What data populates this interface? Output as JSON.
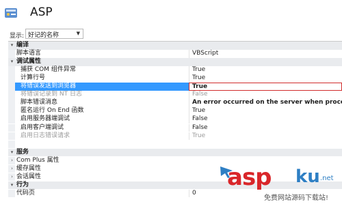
{
  "header": {
    "title": "ASP"
  },
  "toolbar": {
    "display_label": "显示:",
    "display_value": "好记的名称"
  },
  "grid": {
    "rows": [
      {
        "type": "cat",
        "label": "编译",
        "expander": "▾"
      },
      {
        "type": "item",
        "label": "脚本语言",
        "value": "VBScript"
      },
      {
        "type": "cat",
        "label": "调试属性",
        "expander": "▾"
      },
      {
        "type": "sub",
        "label": "捕获 COM 组件异常",
        "value": "True"
      },
      {
        "type": "sub",
        "label": "计算行号",
        "value": "True"
      },
      {
        "type": "sub",
        "label": "将错误发送到浏览器",
        "value": "True",
        "selected": true
      },
      {
        "type": "sub",
        "label": "将错误记录到 NT 日志",
        "value": "False",
        "disabled": true
      },
      {
        "type": "sub",
        "label": "脚本错误消息",
        "value": "An error occurred on the server when processing the",
        "bold": true
      },
      {
        "type": "sub",
        "label": "匿名运行 On End 函数",
        "value": "True"
      },
      {
        "type": "sub",
        "label": "启用服务器端调试",
        "value": "False"
      },
      {
        "type": "sub",
        "label": "启用客户端调试",
        "value": "False"
      },
      {
        "type": "sub",
        "label": "启用日志错误请求",
        "value": "True",
        "disabled": true
      },
      {
        "type": "blank"
      },
      {
        "type": "cat",
        "label": "服务",
        "expander": "▾"
      },
      {
        "type": "item",
        "label": "Com Plus 属性",
        "expander": "›"
      },
      {
        "type": "item",
        "label": "缓存属性",
        "expander": "›"
      },
      {
        "type": "item",
        "label": "会话属性",
        "expander": "›"
      },
      {
        "type": "cat",
        "label": "行为",
        "expander": "▾"
      },
      {
        "type": "item",
        "label": "代码页",
        "value": "0"
      }
    ]
  },
  "watermark": {
    "asp": "asp",
    "ku": "ku",
    "net": ".net",
    "sub": "免费网站源码下载站!"
  },
  "colors": {
    "selection": "#3399ff",
    "highlight_border": "#d12c2c",
    "watermark_red": "#d9262a",
    "watermark_blue": "#2e7fc4"
  }
}
